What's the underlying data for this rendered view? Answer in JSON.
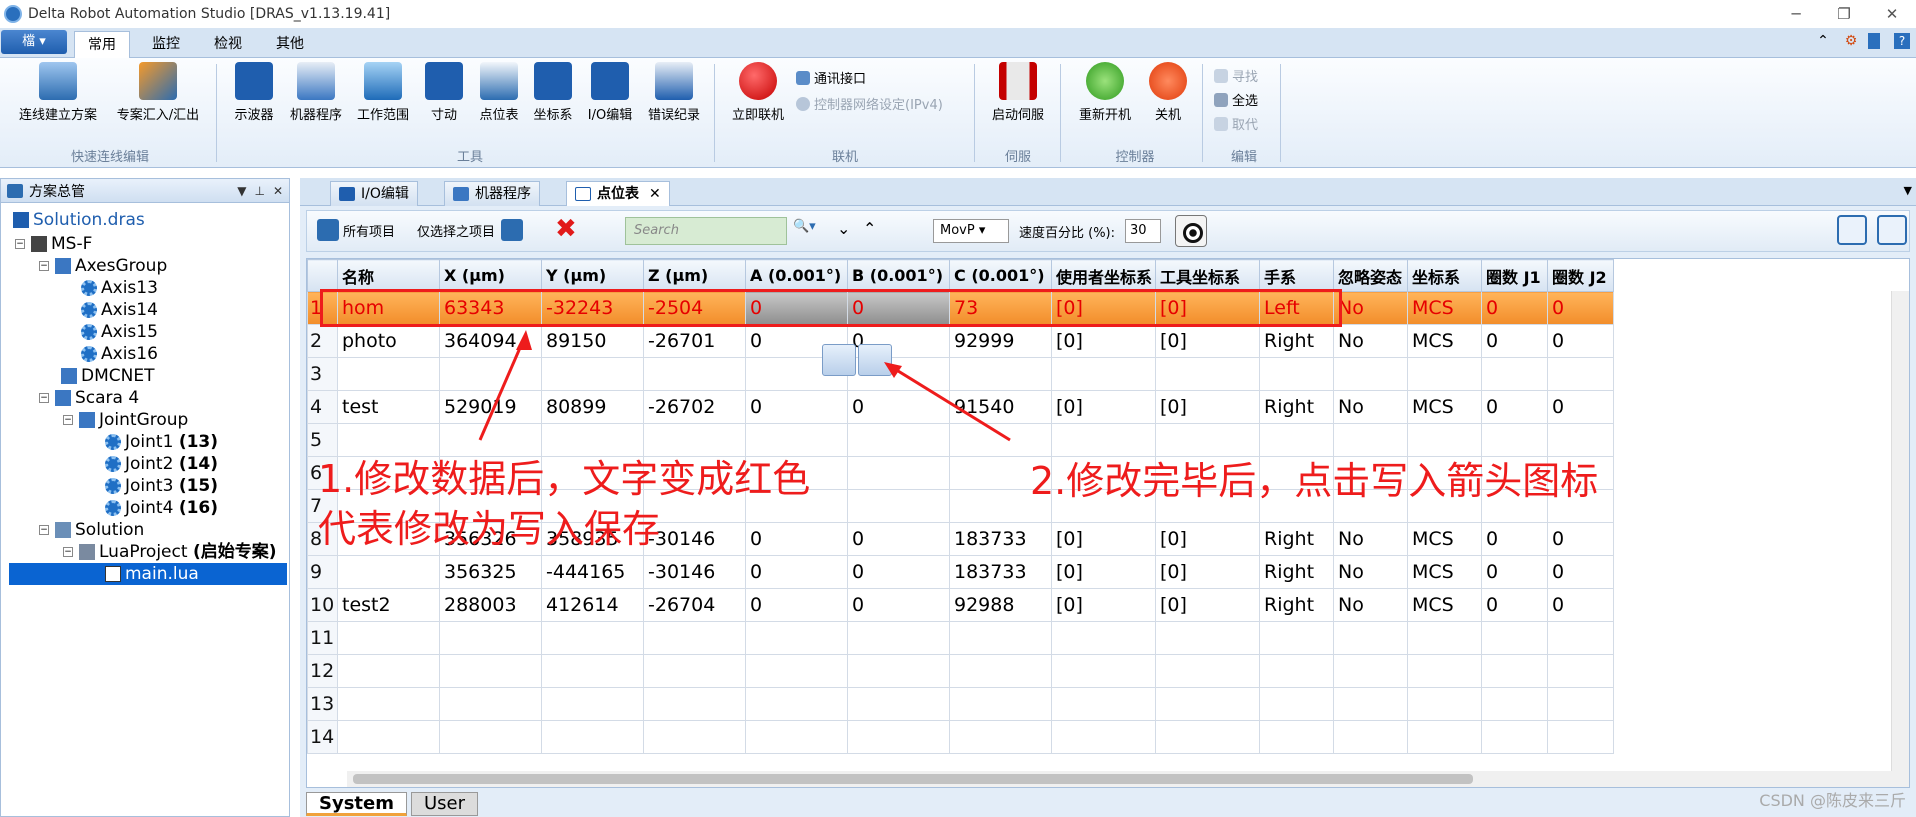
{
  "window": {
    "title": "Delta Robot Automation Studio [DRAS_v1.13.19.41]"
  },
  "ribbon_tabs": {
    "menu": "檔 ▾",
    "tabs": [
      "常用",
      "监控",
      "检视",
      "其他"
    ]
  },
  "ribbon": {
    "quick": {
      "btn1": "连线建立方案",
      "btn2": "专案汇入/汇出",
      "label": "快速连线编辑"
    },
    "tools": {
      "btns": [
        "示波器",
        "机器程序",
        "工作范围",
        "寸动",
        "点位表",
        "坐标系",
        "I/O编辑",
        "错误纪录"
      ],
      "label": "工具"
    },
    "online": {
      "btn": "立即联机",
      "comm": "通讯接口",
      "ipv4": "控制器网络设定(IPv4)",
      "label": "联机"
    },
    "servo": {
      "btn": "启动伺服",
      "label": "伺服"
    },
    "controller": {
      "restart": "重新开机",
      "shutdown": "关机",
      "label": "控制器"
    },
    "edit": {
      "find": "寻找",
      "select_all": "全选",
      "replace": "取代",
      "label": "编辑"
    }
  },
  "solution_panel": {
    "title": "方案总管"
  },
  "tree": {
    "root": "Solution.dras",
    "msf": "MS-F",
    "axes_group": "AxesGroup",
    "axis13": "Axis13",
    "axis14": "Axis14",
    "axis15": "Axis15",
    "axis16": "Axis16",
    "dmcnet": "DMCNET",
    "scara": "Scara 4",
    "joint_group": "JointGroup",
    "joint1": "Joint1",
    "joint1_n": "(13)",
    "joint2": "Joint2",
    "joint2_n": "(14)",
    "joint3": "Joint3",
    "joint3_n": "(15)",
    "joint4": "Joint4",
    "joint4_n": "(16)",
    "solution": "Solution",
    "lua_project": "LuaProject",
    "lua_project_tag": "(启始专案)",
    "main_lua": "main.lua"
  },
  "doc_tabs": [
    "I/O编辑",
    "机器程序",
    "点位表"
  ],
  "toolbar": {
    "all_items": "所有项目",
    "selected_only": "仅选择之项目",
    "search_placeholder": "Search",
    "move_type": "MovP",
    "speed_label": "速度百分比 (%):",
    "speed_value": "30"
  },
  "grid": {
    "columns": [
      "名称",
      "X (μm)",
      "Y (μm)",
      "Z (μm)",
      "A (0.001°)",
      "B (0.001°)",
      "C (0.001°)",
      "使用者坐标系",
      "工具坐标系",
      "手系",
      "忽略姿态",
      "坐标系",
      "圈数 J1",
      "圈数 J2"
    ],
    "rows": [
      [
        "1",
        "hom",
        "63343",
        "-32243",
        "-2504",
        "0",
        "0",
        "73",
        "[0]",
        "[0]",
        "Left",
        "No",
        "MCS",
        "0",
        "0"
      ],
      [
        "2",
        "photo",
        "364094",
        "89150",
        "-26701",
        "0",
        "0",
        "92999",
        "[0]",
        "[0]",
        "Right",
        "No",
        "MCS",
        "0",
        "0"
      ],
      [
        "3",
        "",
        "",
        "",
        "",
        "",
        "",
        "",
        "",
        "",
        "",
        "",
        "",
        "",
        ""
      ],
      [
        "4",
        "test",
        "529019",
        "80899",
        "-26702",
        "0",
        "0",
        "91540",
        "[0]",
        "[0]",
        "Right",
        "No",
        "MCS",
        "0",
        "0"
      ],
      [
        "5",
        "",
        "",
        "",
        "",
        "",
        "",
        "",
        "",
        "",
        "",
        "",
        "",
        "",
        ""
      ],
      [
        "6",
        "",
        "",
        "",
        "",
        "",
        "",
        "",
        "",
        "",
        "",
        "",
        "",
        "",
        ""
      ],
      [
        "7",
        "",
        "",
        "",
        "",
        "",
        "",
        "",
        "",
        "",
        "",
        "",
        "",
        "",
        ""
      ],
      [
        "8",
        "",
        "356326",
        "358935",
        "-30146",
        "0",
        "0",
        "183733",
        "[0]",
        "[0]",
        "Right",
        "No",
        "MCS",
        "0",
        "0"
      ],
      [
        "9",
        "",
        "356325",
        "-444165",
        "-30146",
        "0",
        "0",
        "183733",
        "[0]",
        "[0]",
        "Right",
        "No",
        "MCS",
        "0",
        "0"
      ],
      [
        "10",
        "test2",
        "288003",
        "412614",
        "-26704",
        "0",
        "0",
        "92988",
        "[0]",
        "[0]",
        "Right",
        "No",
        "MCS",
        "0",
        "0"
      ],
      [
        "11",
        "",
        "",
        "",
        "",
        "",
        "",
        "",
        "",
        "",
        "",
        "",
        "",
        "",
        ""
      ],
      [
        "12",
        "",
        "",
        "",
        "",
        "",
        "",
        "",
        "",
        "",
        "",
        "",
        "",
        "",
        ""
      ],
      [
        "13",
        "",
        "",
        "",
        "",
        "",
        "",
        "",
        "",
        "",
        "",
        "",
        "",
        "",
        ""
      ],
      [
        "14",
        "",
        "",
        "",
        "",
        "",
        "",
        "",
        "",
        "",
        "",
        "",
        "",
        "",
        ""
      ]
    ]
  },
  "bottom_tabs": [
    "System",
    "User"
  ],
  "annotations": {
    "note1_line1": "1.修改数据后，文字变成红色",
    "note1_line2": "代表修改为写入保存",
    "note2": "2.修改完毕后，点击写入箭头图标"
  },
  "watermark": "CSDN @陈皮来三斤",
  "colors": {
    "annotation": "#ee1c1c",
    "highlight_row": "#f28d2a",
    "selection": "#0a64d2"
  }
}
